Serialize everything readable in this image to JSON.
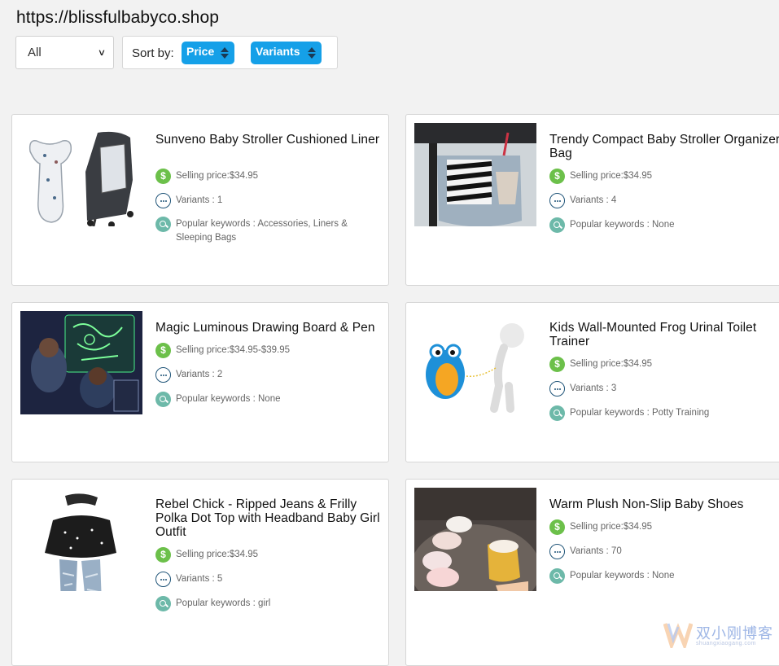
{
  "site_url": "https://blissfulbabyco.shop",
  "filter": {
    "selected": "All"
  },
  "sort": {
    "label": "Sort by:",
    "buttons": [
      "Price",
      "Variants"
    ]
  },
  "labels": {
    "price_prefix": "Selling price:",
    "variants_prefix": "Variants : ",
    "keywords_prefix": "Popular keywords : "
  },
  "colors": {
    "accent": "#15a0e8",
    "price_icon": "#6cc04a",
    "keyword_icon": "#6db9a9",
    "variants_icon": "#1f5478"
  },
  "products": [
    {
      "title": "Sunveno Baby Stroller Cushioned Liner",
      "price": "Selling price:$34.95",
      "variants": "Variants : 1",
      "keywords": "Popular keywords : Accessories, Liners & Sleeping Bags"
    },
    {
      "title": "Trendy Compact Baby Stroller Organizer Bag",
      "price": "Selling price:$34.95",
      "variants": "Variants : 4",
      "keywords": "Popular keywords : None"
    },
    {
      "title": "Magic Luminous Drawing Board & Pen",
      "price": "Selling price:$34.95-$39.95",
      "variants": "Variants : 2",
      "keywords": "Popular keywords : None"
    },
    {
      "title": "Kids Wall-Mounted Frog Urinal Toilet Trainer",
      "price": "Selling price:$34.95",
      "variants": "Variants : 3",
      "keywords": "Popular keywords : Potty Training"
    },
    {
      "title": "Rebel Chick - Ripped Jeans & Frilly Polka Dot Top with Headband Baby Girl Outfit",
      "price": "Selling price:$34.95",
      "variants": "Variants : 5",
      "keywords": "Popular keywords : girl"
    },
    {
      "title": "Warm Plush Non-Slip Baby Shoes",
      "price": "Selling price:$34.95",
      "variants": "Variants : 70",
      "keywords": "Popular keywords : None"
    }
  ],
  "watermark": {
    "text": "双小刚博客",
    "sub": "shuangxiaogang.com"
  }
}
